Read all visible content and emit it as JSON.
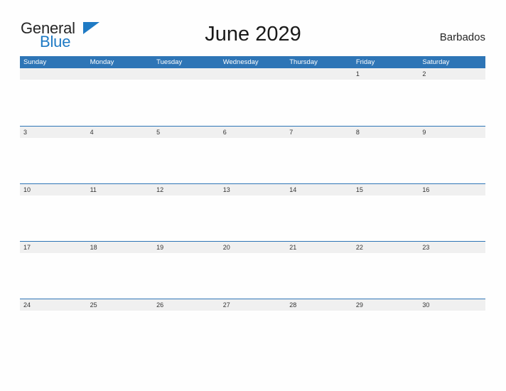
{
  "brand": {
    "name_part1": "General",
    "name_part2": "Blue",
    "flag_icon": "blue-flag-triangle-icon",
    "color_text": "#262626",
    "color_accent": "#1f7ac4"
  },
  "header": {
    "title": "June 2029",
    "locale": "Barbados"
  },
  "colors": {
    "header_blue": "#2e75b6",
    "date_band_gray": "#f0f0f0",
    "page_background": "#fefefe",
    "date_text": "#333333"
  },
  "calendar": {
    "month": "June",
    "year": "2029",
    "weekday_headers": [
      "Sunday",
      "Monday",
      "Tuesday",
      "Wednesday",
      "Thursday",
      "Friday",
      "Saturday"
    ],
    "weeks": [
      {
        "days": [
          "",
          "",
          "",
          "",
          "",
          "1",
          "2"
        ]
      },
      {
        "days": [
          "3",
          "4",
          "5",
          "6",
          "7",
          "8",
          "9"
        ]
      },
      {
        "days": [
          "10",
          "11",
          "12",
          "13",
          "14",
          "15",
          "16"
        ]
      },
      {
        "days": [
          "17",
          "18",
          "19",
          "20",
          "21",
          "22",
          "23"
        ]
      },
      {
        "days": [
          "24",
          "25",
          "26",
          "27",
          "28",
          "29",
          "30"
        ]
      }
    ]
  }
}
